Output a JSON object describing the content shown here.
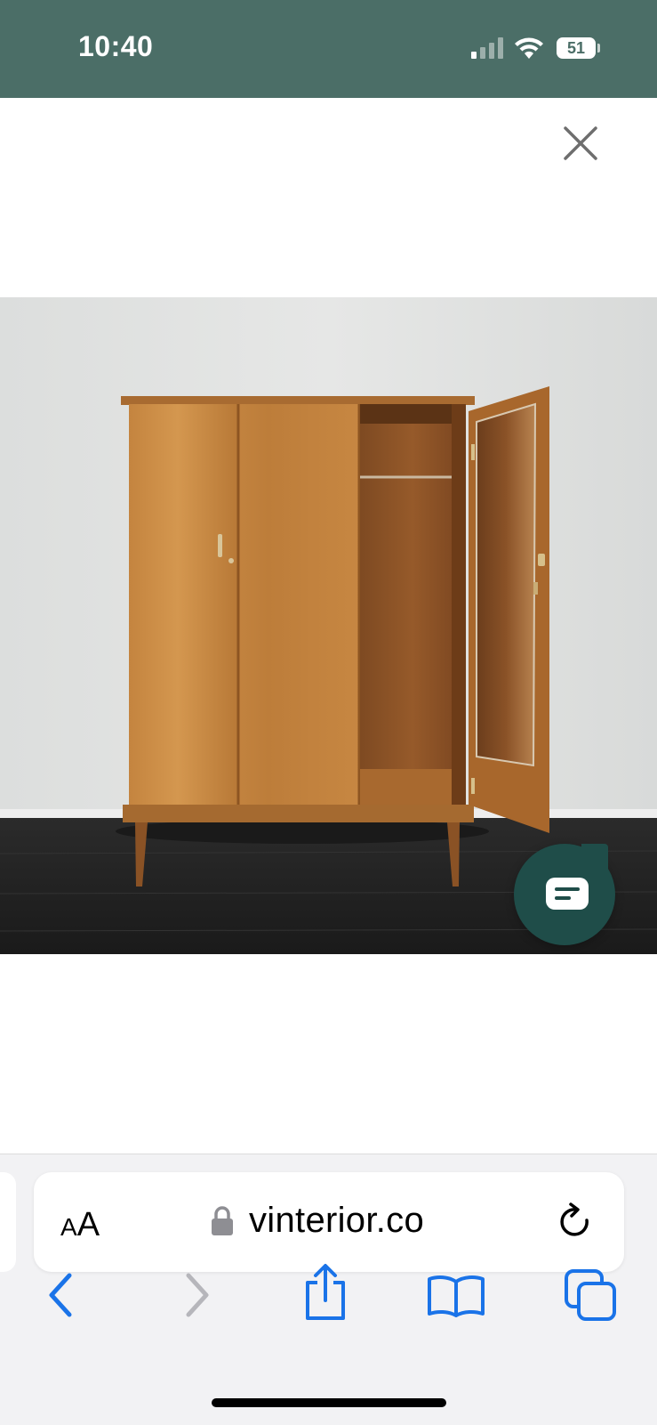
{
  "status_bar": {
    "time": "10:40",
    "battery": "51",
    "signal_bars_active": 1,
    "signal_bars_total": 4,
    "background_color": "#4b6e67"
  },
  "modal": {
    "close_icon": "close-icon"
  },
  "image": {
    "subject": "mid-century walnut wardrobe with one door open and mirror inside"
  },
  "chat_widget": {
    "icon": "chat-icon",
    "color": "#1f4d49"
  },
  "browser": {
    "text_size_label_small": "A",
    "text_size_label_large": "A",
    "url": "vinterior.co",
    "lock_icon": "lock-icon",
    "reload_icon": "reload-icon",
    "accent_color": "#1a73e8",
    "toolbar": [
      {
        "icon": "back-icon",
        "enabled": true
      },
      {
        "icon": "forward-icon",
        "enabled": false
      },
      {
        "icon": "share-icon",
        "enabled": true
      },
      {
        "icon": "bookmarks-icon",
        "enabled": true
      },
      {
        "icon": "tabs-icon",
        "enabled": true
      }
    ]
  }
}
